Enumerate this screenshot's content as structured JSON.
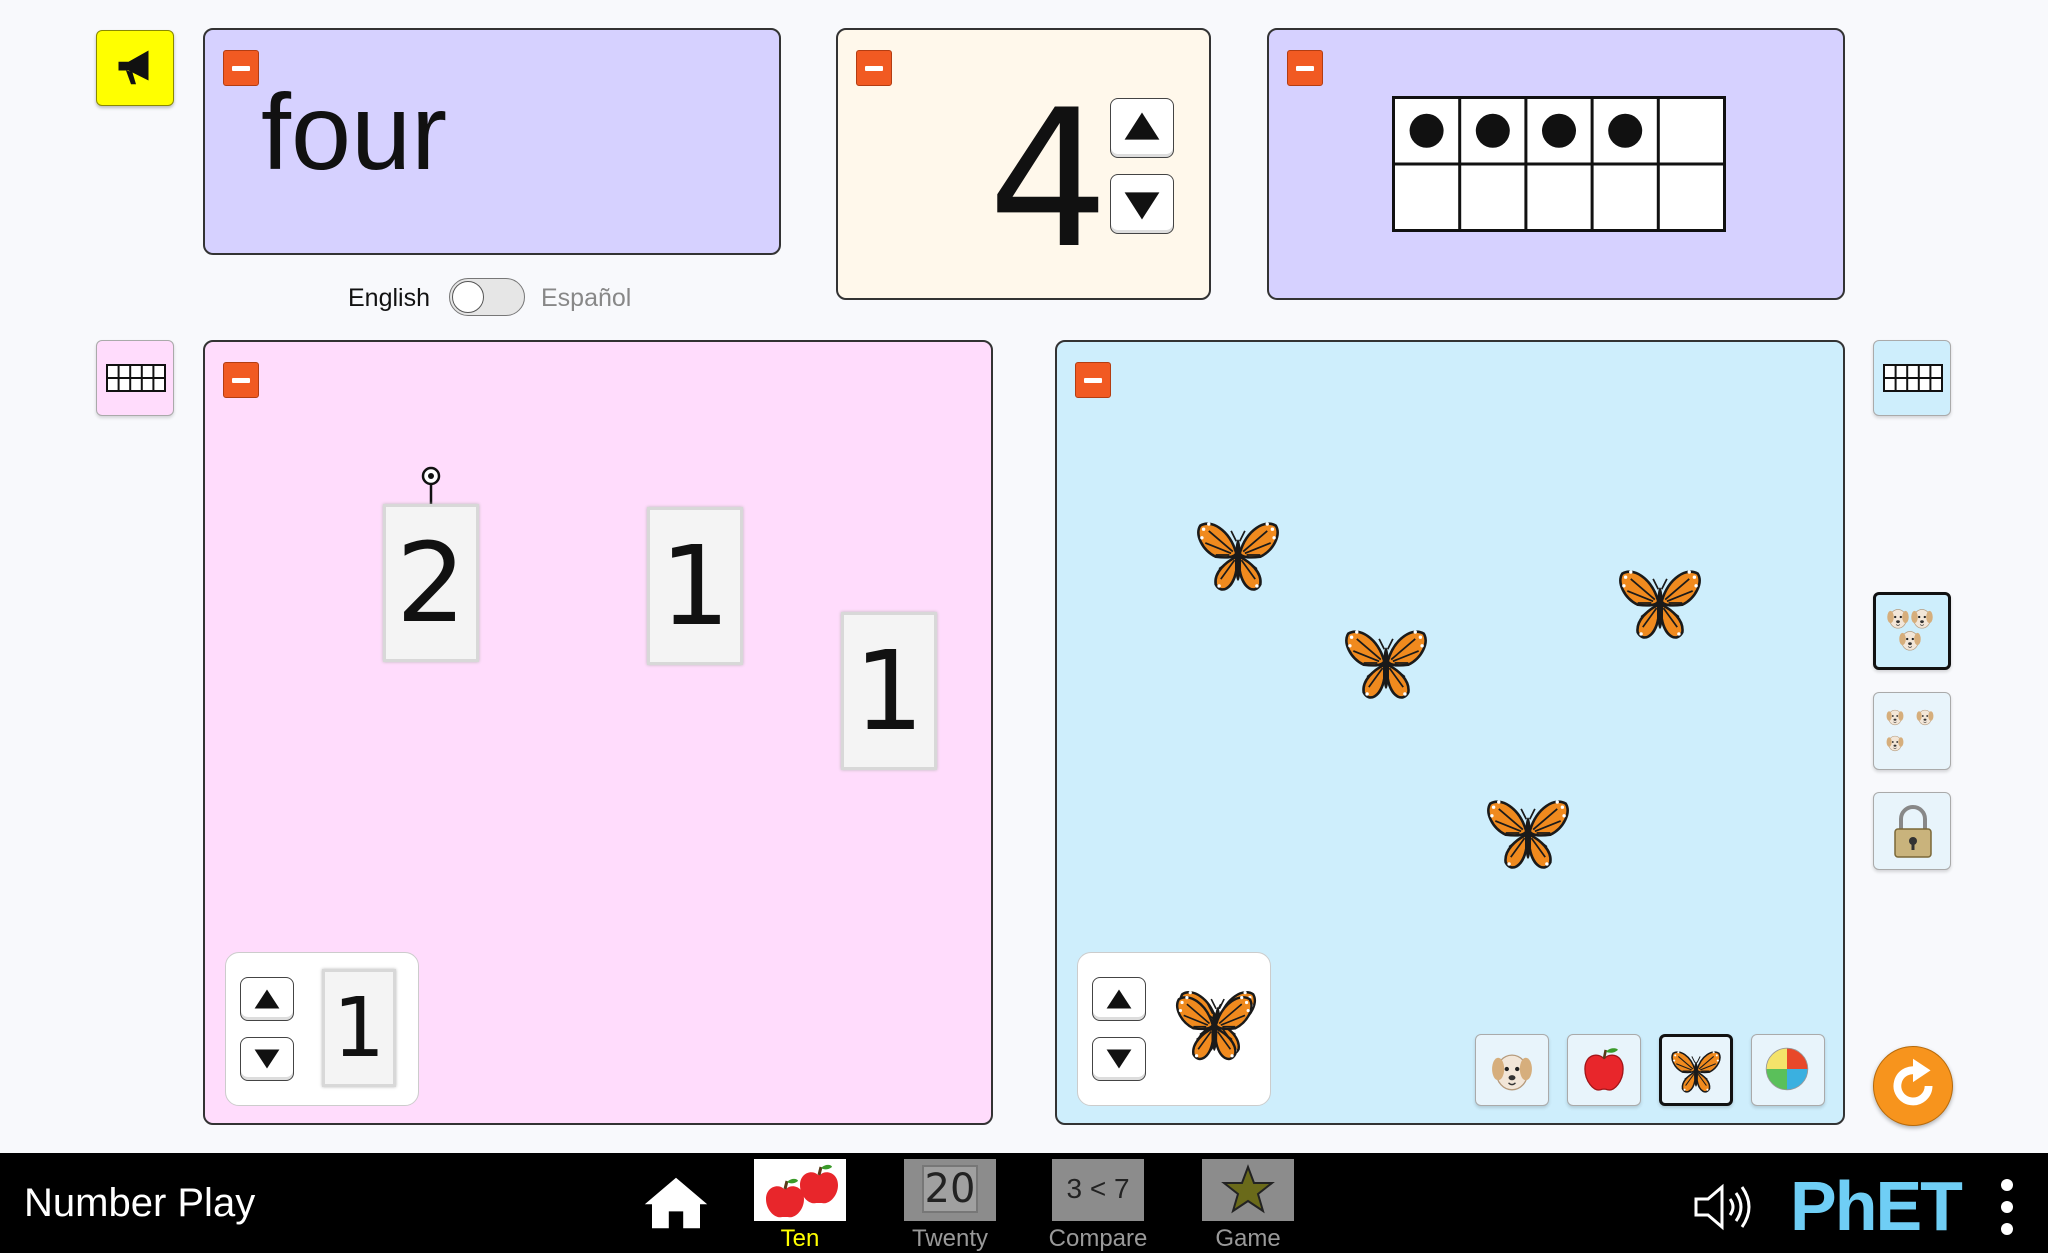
{
  "word_panel": {
    "word": "four"
  },
  "language_toggle": {
    "left_label": "English",
    "right_label": "Español"
  },
  "number_panel": {
    "value": "4"
  },
  "ten_frame": {
    "filled": 4,
    "total": 10
  },
  "left_play_area": {
    "cards": [
      "2",
      "1",
      "1"
    ],
    "creator_card": "1"
  },
  "right_play_area": {
    "object": "butterfly",
    "count": 4,
    "object_types": [
      "dog-icon",
      "apple-icon",
      "butterfly-icon",
      "ball-icon"
    ],
    "selected_type": "butterfly-icon"
  },
  "navbar": {
    "title": "Number Play",
    "tabs": [
      {
        "label": "Ten",
        "icon": "apples-icon",
        "selected": true
      },
      {
        "label": "Twenty",
        "icon_text": "20"
      },
      {
        "label": "Compare",
        "icon_text": "3 < 7"
      },
      {
        "label": "Game",
        "icon": "star-icon"
      }
    ],
    "brand": "PhET"
  },
  "colors": {
    "word_panel_bg": "#d6d1ff",
    "number_panel_bg": "#fff8eb",
    "ten_frame_panel_bg": "#d6d1ff",
    "left_area_bg": "#ffdcfc",
    "right_area_bg": "#ceeefc",
    "minus_button": "#f15a22",
    "speaker_button": "#ffff00",
    "selected_tab_label": "#ffff00",
    "phet_blue": "#6fcef5"
  }
}
